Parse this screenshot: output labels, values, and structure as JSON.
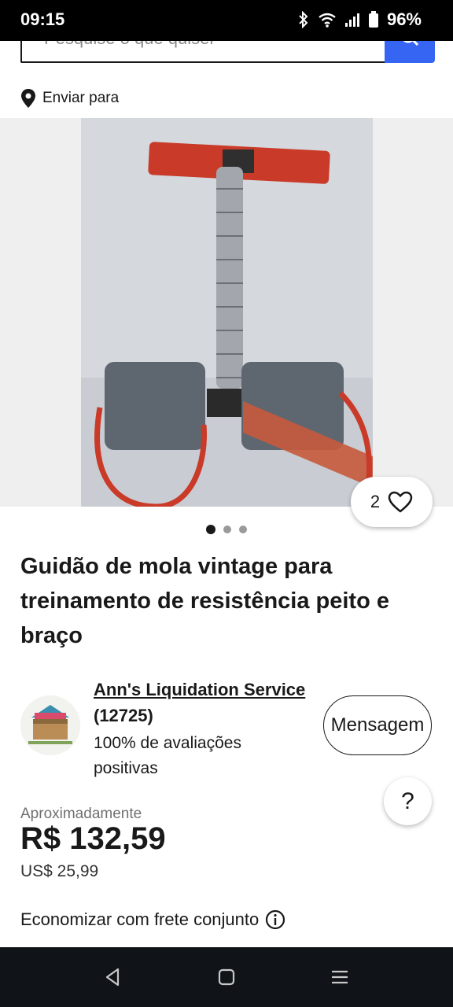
{
  "status_bar": {
    "time": "09:15",
    "battery": "96%"
  },
  "search": {
    "placeholder": "Pesquise o que quiser"
  },
  "shipping_to": {
    "label": "Enviar para"
  },
  "gallery": {
    "image_count": 3,
    "active_index": 0,
    "watch_count": "2"
  },
  "listing": {
    "title": "Guidão de mola vintage para treinamento de resistência peito e braço"
  },
  "seller": {
    "name": "Ann's Liquidation Service",
    "score": "(12725)",
    "feedback": "100% de avaliações positivas",
    "message_label": "Mensagem"
  },
  "help": {
    "label": "?"
  },
  "price": {
    "approx_label": "Aproximadamente",
    "value": "R$ 132,59",
    "original": "US$ 25,99"
  },
  "shipping": {
    "label": "Economizar com frete conjunto"
  },
  "colors": {
    "accent": "#3665f3",
    "text": "#191919",
    "nav_bar": "#101418"
  }
}
